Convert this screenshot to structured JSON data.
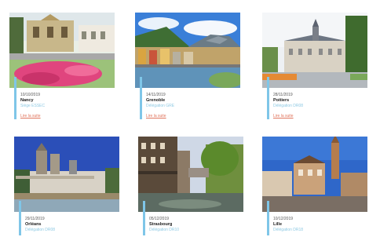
{
  "cards": [
    {
      "date": "10/10/2019",
      "city": "Nancy",
      "subtitle": "Siège ESSEC",
      "link": "Lire la suite"
    },
    {
      "date": "14/11/2019",
      "city": "Grenoble",
      "subtitle": "Délégation GRE",
      "link": "Lire la suite"
    },
    {
      "date": "28/11/2019",
      "city": "Poitiers",
      "subtitle": "Délégation DR08",
      "link": "Lire la suite"
    },
    {
      "date": "29/11/2019",
      "city": "Orléans",
      "subtitle": "Délégation DR08"
    },
    {
      "date": "05/12/2019",
      "city": "Strasbourg",
      "subtitle": "Délégation DR10"
    },
    {
      "date": "10/12/2019",
      "city": "Lille",
      "subtitle": "Délégation DR18"
    }
  ]
}
